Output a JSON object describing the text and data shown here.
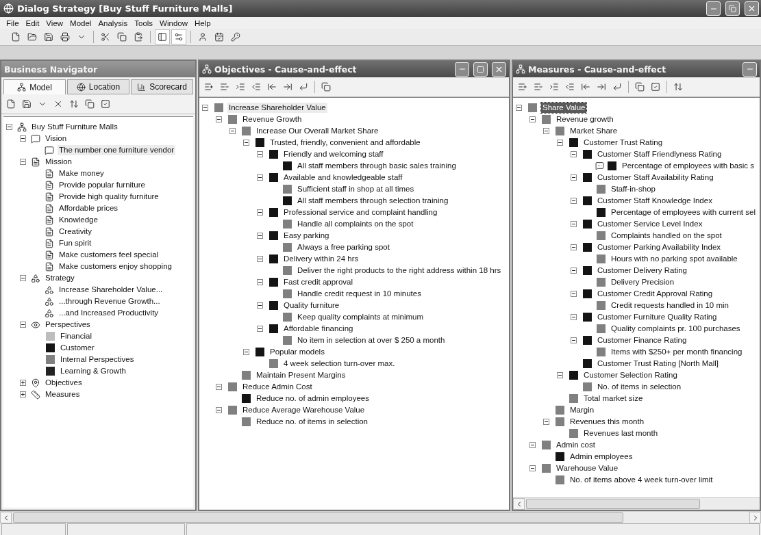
{
  "window": {
    "title": "Dialog Strategy [Buy Stuff Furniture Malls]"
  },
  "menu": [
    "File",
    "Edit",
    "View",
    "Model",
    "Analysis",
    "Tools",
    "Window",
    "Help"
  ],
  "navigator": {
    "title": "Business Navigator",
    "tabs": [
      {
        "label": "Model",
        "kind": "model",
        "selected": true
      },
      {
        "label": "Location",
        "kind": "location",
        "selected": false
      },
      {
        "label": "Scorecard",
        "kind": "scorecard",
        "selected": false
      }
    ],
    "tree": [
      {
        "label": "Buy Stuff Furniture Malls",
        "kind": "org",
        "expanded": true,
        "selected": false,
        "children": [
          {
            "label": "Vision",
            "kind": "vision",
            "expanded": true,
            "selected": false,
            "children": [
              {
                "label": "The number one furniture vendor",
                "kind": "vision",
                "selected": true
              }
            ]
          },
          {
            "label": "Mission",
            "kind": "mission",
            "expanded": true,
            "selected": false,
            "children": [
              {
                "label": "Make money",
                "kind": "mission",
                "selected": false
              },
              {
                "label": "Provide popular furniture",
                "kind": "mission",
                "selected": false
              },
              {
                "label": "Provide high quality furniture",
                "kind": "mission",
                "selected": false
              },
              {
                "label": "Affordable prices",
                "kind": "mission",
                "selected": false
              },
              {
                "label": "Knowledge",
                "kind": "mission",
                "selected": false
              },
              {
                "label": "Creativity",
                "kind": "mission",
                "selected": false
              },
              {
                "label": "Fun spirit",
                "kind": "mission",
                "selected": false
              },
              {
                "label": "Make customers feel special",
                "kind": "mission",
                "selected": false
              },
              {
                "label": "Make customers enjoy shopping",
                "kind": "mission",
                "selected": false
              }
            ]
          },
          {
            "label": "Strategy",
            "kind": "strategy",
            "expanded": true,
            "selected": false,
            "children": [
              {
                "label": "Increase Shareholder Value...",
                "kind": "strategy",
                "selected": false
              },
              {
                "label": "...through Revenue Growth...",
                "kind": "strategy",
                "selected": false
              },
              {
                "label": "...and Increased Productivity",
                "kind": "strategy",
                "selected": false
              }
            ]
          },
          {
            "label": "Perspectives",
            "kind": "perspectives",
            "expanded": true,
            "selected": false,
            "children": [
              {
                "label": "Financial",
                "color": "#bdbdbd",
                "selected": false
              },
              {
                "label": "Customer",
                "color": "#141414",
                "selected": false
              },
              {
                "label": "Internal Perspectives",
                "color": "#808080",
                "selected": false
              },
              {
                "label": "Learning & Growth",
                "color": "#222222",
                "selected": false
              }
            ]
          },
          {
            "label": "Objectives",
            "kind": "objectives",
            "expanded": false,
            "selected": false
          },
          {
            "label": "Measures",
            "kind": "measures",
            "expanded": false,
            "selected": false
          }
        ]
      }
    ]
  },
  "objectives": {
    "title": "Objectives - Cause-and-effect",
    "active": false,
    "tree": [
      {
        "label": "Increase Shareholder Value",
        "color": "#808080",
        "expanded": true,
        "selected": true,
        "children": [
          {
            "label": "Revenue Growth",
            "color": "#808080",
            "expanded": true,
            "selected": false,
            "children": [
              {
                "label": "Increase Our Overall Market Share",
                "color": "#808080",
                "expanded": true,
                "selected": false,
                "children": [
                  {
                    "label": "Trusted, friendly, convenient and affordable",
                    "color": "#141414",
                    "expanded": true,
                    "selected": false,
                    "children": [
                      {
                        "label": "Friendly and welcoming staff",
                        "color": "#141414",
                        "expanded": true,
                        "selected": false,
                        "children": [
                          {
                            "label": "All staff members through basic sales training",
                            "color": "#141414",
                            "selected": false
                          }
                        ]
                      },
                      {
                        "label": "Available and knowledgeable staff",
                        "color": "#141414",
                        "expanded": true,
                        "selected": false,
                        "children": [
                          {
                            "label": "Sufficient staff in shop at all times",
                            "color": "#808080",
                            "selected": false
                          },
                          {
                            "label": "All staff members through selection training",
                            "color": "#141414",
                            "selected": false
                          }
                        ]
                      },
                      {
                        "label": "Professional service and complaint handling",
                        "color": "#141414",
                        "expanded": true,
                        "selected": false,
                        "children": [
                          {
                            "label": "Handle all complaints on the spot",
                            "color": "#808080",
                            "selected": false
                          }
                        ]
                      },
                      {
                        "label": "Easy parking",
                        "color": "#141414",
                        "expanded": true,
                        "selected": false,
                        "children": [
                          {
                            "label": "Always a free parking spot",
                            "color": "#808080",
                            "selected": false
                          }
                        ]
                      },
                      {
                        "label": "Delivery within 24 hrs",
                        "color": "#141414",
                        "expanded": true,
                        "selected": false,
                        "children": [
                          {
                            "label": "Deliver the right products to the right address within 18 hrs",
                            "color": "#808080",
                            "selected": false
                          }
                        ]
                      },
                      {
                        "label": "Fast credit approval",
                        "color": "#141414",
                        "expanded": true,
                        "selected": false,
                        "children": [
                          {
                            "label": "Handle credit request in 10 minutes",
                            "color": "#808080",
                            "selected": false
                          }
                        ]
                      },
                      {
                        "label": "Quality furniture",
                        "color": "#141414",
                        "expanded": true,
                        "selected": false,
                        "children": [
                          {
                            "label": "Keep quality complaints at minimum",
                            "color": "#808080",
                            "selected": false
                          }
                        ]
                      },
                      {
                        "label": "Affordable financing",
                        "color": "#141414",
                        "expanded": true,
                        "selected": false,
                        "children": [
                          {
                            "label": "No item in selection at over $ 250 a month",
                            "color": "#808080",
                            "selected": false
                          }
                        ]
                      }
                    ]
                  },
                  {
                    "label": "Popular models",
                    "color": "#141414",
                    "expanded": true,
                    "selected": false,
                    "children": [
                      {
                        "label": "4 week selection turn-over max.",
                        "color": "#808080",
                        "selected": false
                      }
                    ]
                  }
                ]
              },
              {
                "label": "Maintain Present Margins",
                "color": "#808080",
                "selected": false
              }
            ]
          },
          {
            "label": "Reduce Admin Cost",
            "color": "#808080",
            "expanded": true,
            "selected": false,
            "children": [
              {
                "label": "Reduce no. of admin employees",
                "color": "#141414",
                "selected": false
              }
            ]
          },
          {
            "label": "Reduce Average Warehouse Value",
            "color": "#808080",
            "expanded": true,
            "selected": false,
            "children": [
              {
                "label": "Reduce no. of items in selection",
                "color": "#808080",
                "selected": false
              }
            ]
          }
        ]
      }
    ]
  },
  "measures": {
    "title": "Measures - Cause-and-effect",
    "active": true,
    "tree": [
      {
        "label": "Share Value",
        "color": "#808080",
        "expanded": true,
        "selected": true,
        "children": [
          {
            "label": "Revenue growth",
            "color": "#808080",
            "expanded": true,
            "selected": false,
            "children": [
              {
                "label": "Market Share",
                "color": "#808080",
                "expanded": true,
                "selected": false,
                "children": [
                  {
                    "label": "Customer Trust Rating",
                    "color": "#141414",
                    "expanded": true,
                    "selected": false,
                    "children": [
                      {
                        "label": "Customer Staff Friendlyness Rating",
                        "color": "#141414",
                        "expanded": true,
                        "selected": false,
                        "children": [
                          {
                            "label": "Percentage of employees with basic s",
                            "color": "#141414",
                            "selected": false,
                            "noted": true
                          }
                        ]
                      },
                      {
                        "label": "Customer Staff Availability Rating",
                        "color": "#141414",
                        "expanded": true,
                        "selected": false,
                        "children": [
                          {
                            "label": "Staff-in-shop",
                            "color": "#808080",
                            "selected": false
                          }
                        ]
                      },
                      {
                        "label": "Customer Staff Knowledge Index",
                        "color": "#141414",
                        "expanded": true,
                        "selected": false,
                        "children": [
                          {
                            "label": "Percentage of employees with current sel",
                            "color": "#141414",
                            "selected": false
                          }
                        ]
                      },
                      {
                        "label": "Customer Service Level Index",
                        "color": "#141414",
                        "expanded": true,
                        "selected": false,
                        "children": [
                          {
                            "label": "Complaints handled on the spot",
                            "color": "#808080",
                            "selected": false
                          }
                        ]
                      },
                      {
                        "label": "Customer Parking Availability Index",
                        "color": "#141414",
                        "expanded": true,
                        "selected": false,
                        "children": [
                          {
                            "label": "Hours with no parking spot available",
                            "color": "#808080",
                            "selected": false
                          }
                        ]
                      },
                      {
                        "label": "Customer Delivery Rating",
                        "color": "#141414",
                        "expanded": true,
                        "selected": false,
                        "children": [
                          {
                            "label": "Delivery Precision",
                            "color": "#808080",
                            "selected": false
                          }
                        ]
                      },
                      {
                        "label": "Customer Credit Approval Rating",
                        "color": "#141414",
                        "expanded": true,
                        "selected": false,
                        "children": [
                          {
                            "label": "Credit requests handled in 10 min",
                            "color": "#808080",
                            "selected": false
                          }
                        ]
                      },
                      {
                        "label": "Customer Furniture Quality Rating",
                        "color": "#141414",
                        "expanded": true,
                        "selected": false,
                        "children": [
                          {
                            "label": "Quality complaints pr. 100 purchases",
                            "color": "#808080",
                            "selected": false
                          }
                        ]
                      },
                      {
                        "label": "Customer Finance Rating",
                        "color": "#141414",
                        "expanded": true,
                        "selected": false,
                        "children": [
                          {
                            "label": "Items with $250+ per month financing",
                            "color": "#808080",
                            "selected": false
                          }
                        ]
                      },
                      {
                        "label": "Customer Trust Rating [North Mall]",
                        "color": "#141414",
                        "selected": false
                      }
                    ]
                  },
                  {
                    "label": "Customer Selection Rating",
                    "color": "#141414",
                    "expanded": true,
                    "selected": false,
                    "children": [
                      {
                        "label": "No. of items in selection",
                        "color": "#808080",
                        "selected": false
                      }
                    ]
                  },
                  {
                    "label": "Total market size",
                    "color": "#808080",
                    "selected": false
                  }
                ]
              },
              {
                "label": "Margin",
                "color": "#808080",
                "selected": false
              },
              {
                "label": "Revenues this month",
                "color": "#808080",
                "expanded": true,
                "selected": false,
                "children": [
                  {
                    "label": "Revenues last month",
                    "color": "#808080",
                    "selected": false
                  }
                ]
              }
            ]
          },
          {
            "label": "Admin cost",
            "color": "#808080",
            "expanded": true,
            "selected": false,
            "children": [
              {
                "label": "Admin employees",
                "color": "#141414",
                "selected": false
              }
            ]
          },
          {
            "label": "Warehouse Value",
            "color": "#808080",
            "expanded": true,
            "selected": false,
            "children": [
              {
                "label": "No. of items above 4 week turn-over limit",
                "color": "#808080",
                "selected": false
              }
            ]
          }
        ]
      }
    ]
  }
}
